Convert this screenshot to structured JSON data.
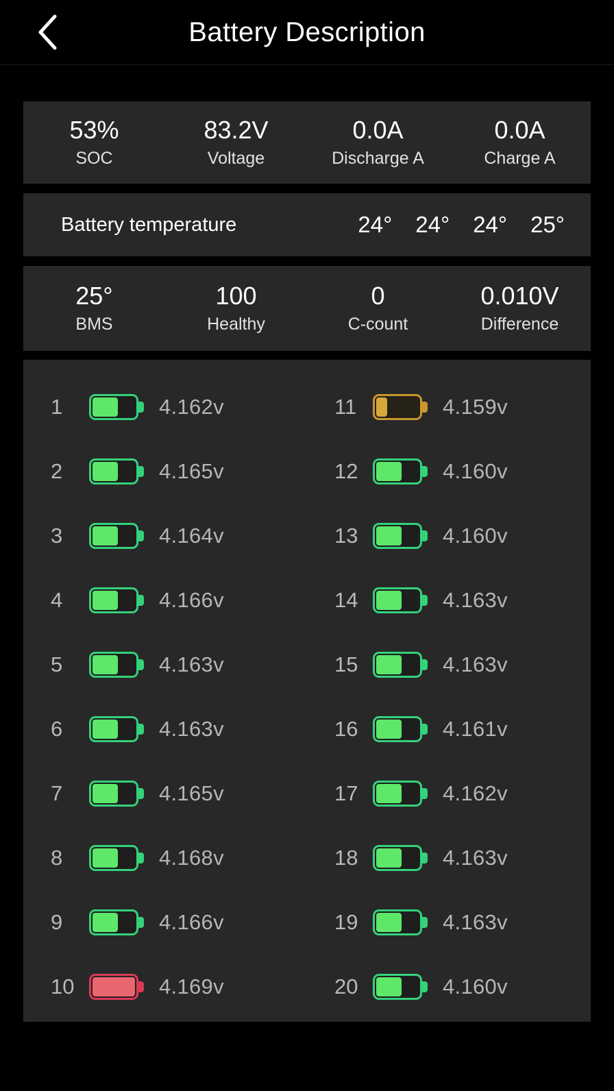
{
  "header": {
    "title": "Battery Description",
    "back_icon": "chevron-left-icon"
  },
  "summary": {
    "items": [
      {
        "value": "53%",
        "label": "SOC"
      },
      {
        "value": "83.2V",
        "label": "Voltage"
      },
      {
        "value": "0.0A",
        "label": "Discharge A"
      },
      {
        "value": "0.0A",
        "label": "Charge A"
      }
    ]
  },
  "temperature": {
    "label": "Battery temperature",
    "values": [
      "24°",
      "24°",
      "24°",
      "25°"
    ]
  },
  "health": {
    "items": [
      {
        "value": "25°",
        "label": "BMS"
      },
      {
        "value": "100",
        "label": "Healthy"
      },
      {
        "value": "0",
        "label": "C-count"
      },
      {
        "value": "0.010V",
        "label": "Difference"
      }
    ]
  },
  "colors": {
    "page_background": "#000000",
    "panel_background": "#282828",
    "accent_green": "#34d27b",
    "fill_green": "#5de86a",
    "accent_amber": "#c9972c",
    "fill_amber": "#d8a83a",
    "accent_red": "#d93b57",
    "fill_red": "#e8676f",
    "value_text": "#ffffff",
    "muted_text": "#b5b5b5"
  },
  "cells": {
    "unit_suffix": "v",
    "list": [
      {
        "index": "1",
        "voltage": "4.162v",
        "state": "normal",
        "fill_pct": 60
      },
      {
        "index": "2",
        "voltage": "4.165v",
        "state": "normal",
        "fill_pct": 60
      },
      {
        "index": "3",
        "voltage": "4.164v",
        "state": "normal",
        "fill_pct": 60
      },
      {
        "index": "4",
        "voltage": "4.166v",
        "state": "normal",
        "fill_pct": 60
      },
      {
        "index": "5",
        "voltage": "4.163v",
        "state": "normal",
        "fill_pct": 60
      },
      {
        "index": "6",
        "voltage": "4.163v",
        "state": "normal",
        "fill_pct": 60
      },
      {
        "index": "7",
        "voltage": "4.165v",
        "state": "normal",
        "fill_pct": 60
      },
      {
        "index": "8",
        "voltage": "4.168v",
        "state": "normal",
        "fill_pct": 60
      },
      {
        "index": "9",
        "voltage": "4.166v",
        "state": "normal",
        "fill_pct": 60
      },
      {
        "index": "10",
        "voltage": "4.169v",
        "state": "high",
        "fill_pct": 100
      },
      {
        "index": "11",
        "voltage": "4.159v",
        "state": "low",
        "fill_pct": 25
      },
      {
        "index": "12",
        "voltage": "4.160v",
        "state": "normal",
        "fill_pct": 60
      },
      {
        "index": "13",
        "voltage": "4.160v",
        "state": "normal",
        "fill_pct": 60
      },
      {
        "index": "14",
        "voltage": "4.163v",
        "state": "normal",
        "fill_pct": 60
      },
      {
        "index": "15",
        "voltage": "4.163v",
        "state": "normal",
        "fill_pct": 60
      },
      {
        "index": "16",
        "voltage": "4.161v",
        "state": "normal",
        "fill_pct": 60
      },
      {
        "index": "17",
        "voltage": "4.162v",
        "state": "normal",
        "fill_pct": 60
      },
      {
        "index": "18",
        "voltage": "4.163v",
        "state": "normal",
        "fill_pct": 60
      },
      {
        "index": "19",
        "voltage": "4.163v",
        "state": "normal",
        "fill_pct": 60
      },
      {
        "index": "20",
        "voltage": "4.160v",
        "state": "normal",
        "fill_pct": 60
      }
    ]
  }
}
